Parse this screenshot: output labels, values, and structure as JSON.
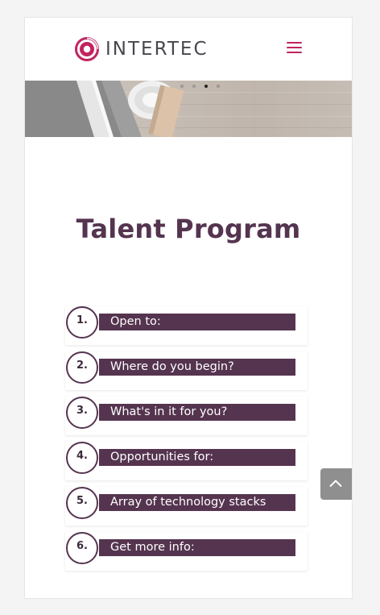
{
  "brand": {
    "name": "INTERTEC",
    "mark_color": "#c0245f",
    "text_color": "#4a4650"
  },
  "header": {
    "menu_icon": "hamburger-menu-icon"
  },
  "hero": {
    "slides_total": 4,
    "active_slide": 3
  },
  "page": {
    "title": "Talent Program",
    "accent_color": "#55344f"
  },
  "accordion": {
    "items": [
      {
        "number": "1.",
        "label": "Open to:"
      },
      {
        "number": "2.",
        "label": "Where do you begin?"
      },
      {
        "number": "3.",
        "label": "What's in it for you?"
      },
      {
        "number": "4.",
        "label": "Opportunities for:"
      },
      {
        "number": "5.",
        "label": "Array of technology stacks"
      },
      {
        "number": "6.",
        "label": "Get more info:"
      }
    ]
  },
  "scroll_to_top": {
    "icon": "chevron-up-icon"
  }
}
